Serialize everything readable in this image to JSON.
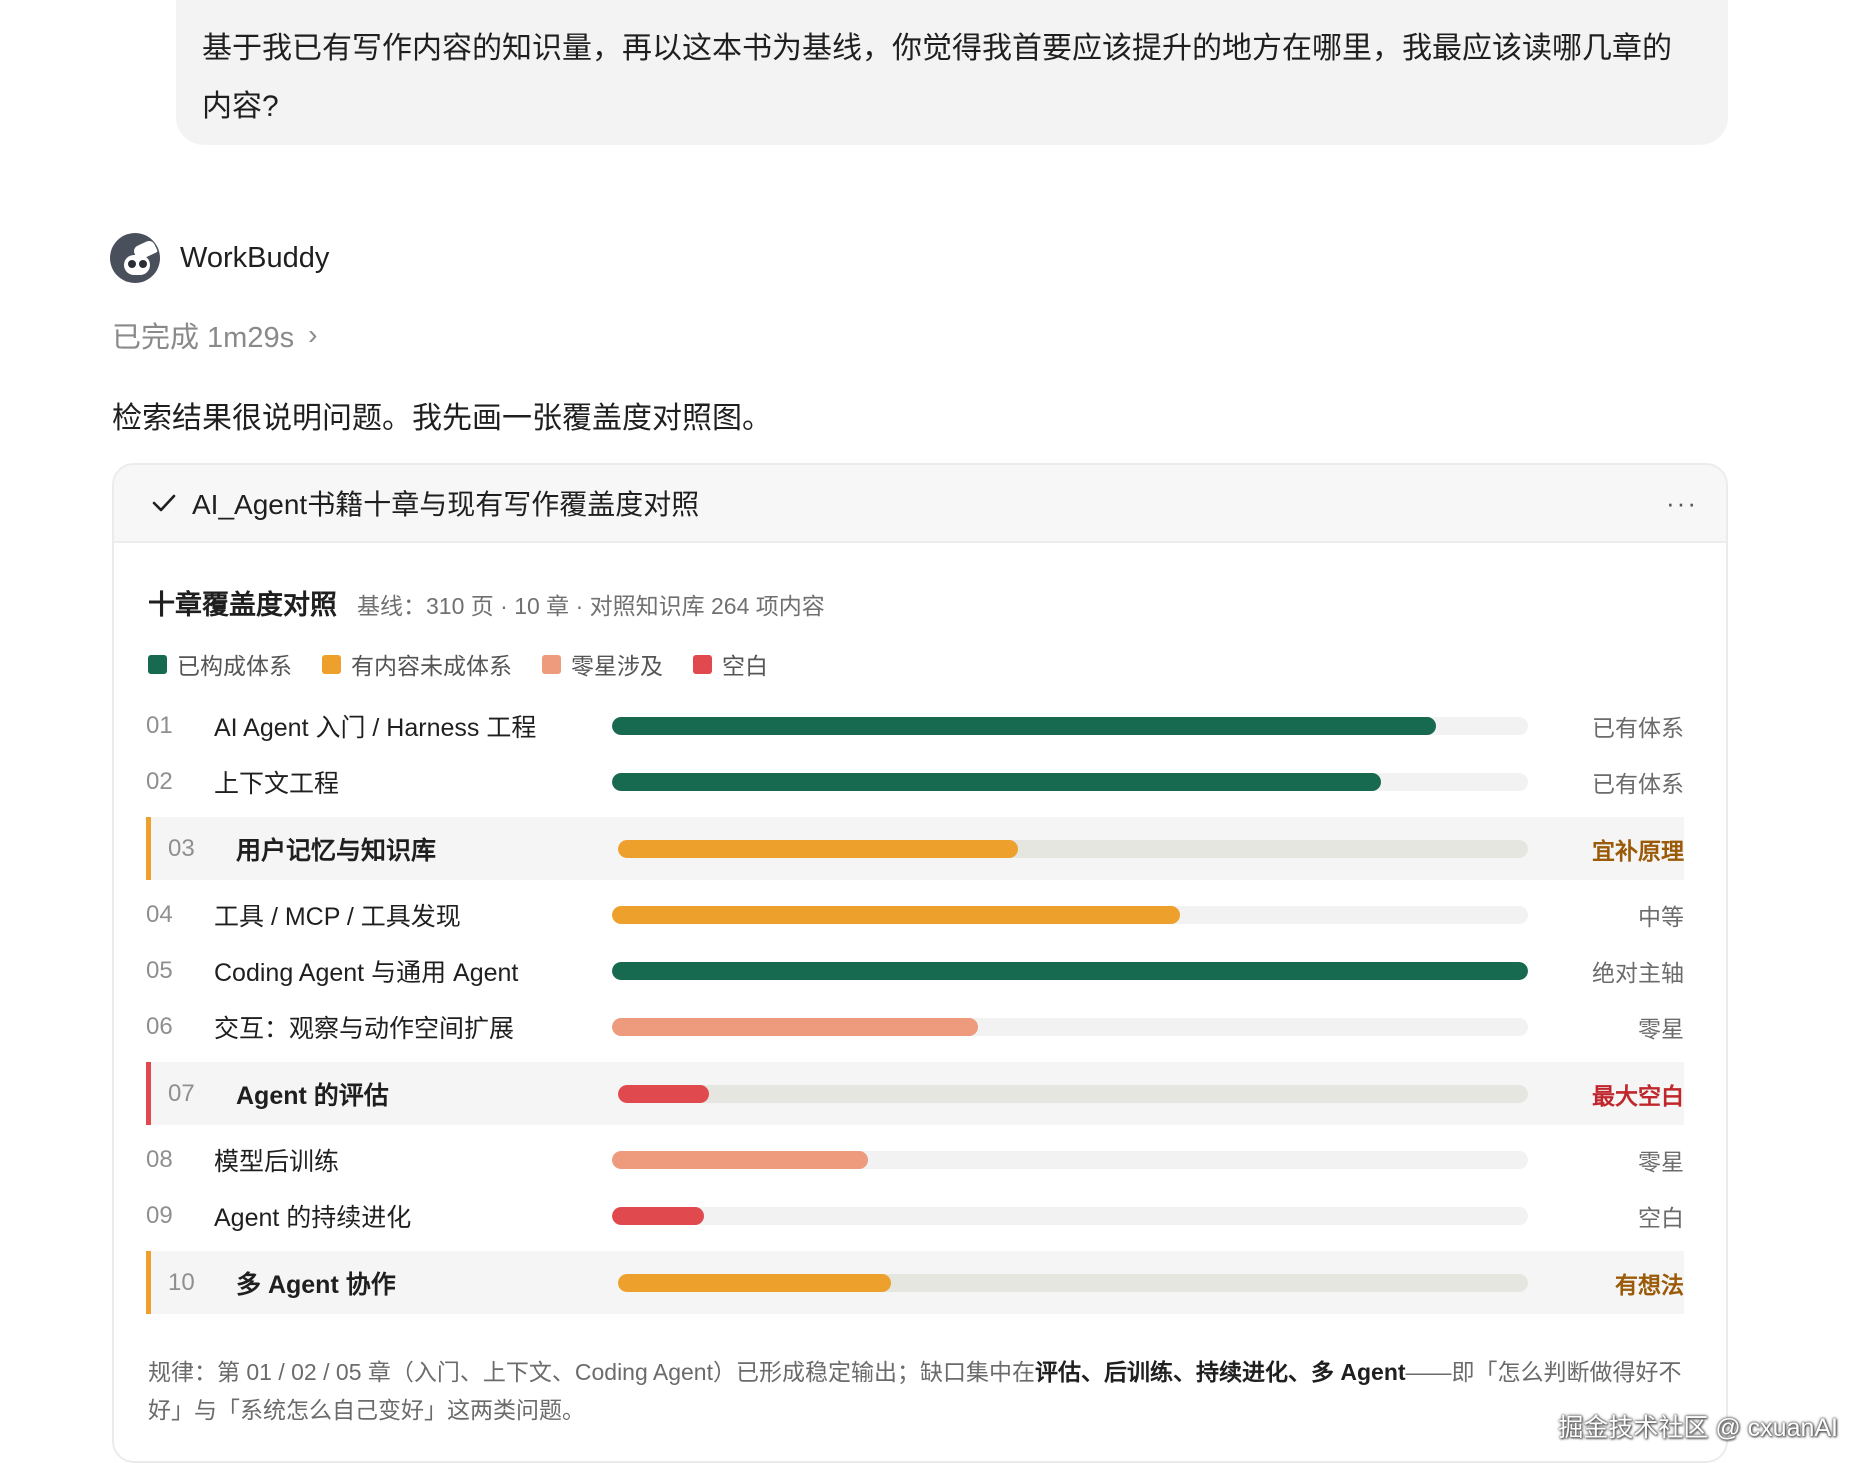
{
  "user_message": {
    "line1": "基于我已有写作内容的知识量，再以这本书为基线，你觉得我首要应该提升的地方在哪里，我最应该读哪几章的",
    "line2": "内容?"
  },
  "agent": {
    "name": "WorkBuddy",
    "status": "已完成 1m29s",
    "status_icon": "chevron-right-icon",
    "intro": "检索结果很说明问题。我先画一张覆盖度对照图。"
  },
  "card": {
    "title": "AI_Agent书籍十章与现有写作覆盖度对照",
    "more": "···"
  },
  "chart_data": {
    "type": "bar",
    "title": "十章覆盖度对照",
    "subtitle": "基线：310 页 · 10 章 · 对照知识库 264 项内容",
    "legend": [
      {
        "label": "已构成体系",
        "color": "#17694f"
      },
      {
        "label": "有内容未成体系",
        "color": "#eea02c"
      },
      {
        "label": "零星涉及",
        "color": "#ee9a7c"
      },
      {
        "label": "空白",
        "color": "#e04a4e"
      }
    ],
    "xlim": [
      0,
      1
    ],
    "rows": [
      {
        "num": "01",
        "label": "AI Agent 入门 / Harness 工程",
        "value": 0.9,
        "color": "#17694f",
        "tag": "已有体系",
        "highlight": false
      },
      {
        "num": "02",
        "label": "上下文工程",
        "value": 0.84,
        "color": "#17694f",
        "tag": "已有体系",
        "highlight": false
      },
      {
        "num": "03",
        "label": "用户记忆与知识库",
        "value": 0.44,
        "color": "#eea02c",
        "tag": "宜补原理",
        "tag_color": "#9a5a08",
        "accent": "#eea02c",
        "highlight": true
      },
      {
        "num": "04",
        "label": "工具 / MCP / 工具发现",
        "value": 0.62,
        "color": "#eea02c",
        "tag": "中等",
        "highlight": false
      },
      {
        "num": "05",
        "label": "Coding Agent 与通用 Agent",
        "value": 1.0,
        "color": "#17694f",
        "tag": "绝对主轴",
        "highlight": false
      },
      {
        "num": "06",
        "label": "交互：观察与动作空间扩展",
        "value": 0.4,
        "color": "#ee9a7c",
        "tag": "零星",
        "highlight": false
      },
      {
        "num": "07",
        "label": "Agent 的评估",
        "value": 0.1,
        "color": "#e04a4e",
        "tag": "最大空白",
        "tag_color": "#c0272d",
        "accent": "#e04a4e",
        "highlight": true
      },
      {
        "num": "08",
        "label": "模型后训练",
        "value": 0.28,
        "color": "#ee9a7c",
        "tag": "零星",
        "highlight": false
      },
      {
        "num": "09",
        "label": "Agent 的持续进化",
        "value": 0.1,
        "color": "#e04a4e",
        "tag": "空白",
        "highlight": false
      },
      {
        "num": "10",
        "label": "多 Agent 协作",
        "value": 0.3,
        "color": "#eea02c",
        "tag": "有想法",
        "tag_color": "#9a5a08",
        "accent": "#eea02c",
        "highlight": true
      }
    ]
  },
  "footnote": {
    "prefix": "规律：第 01 / 02 / 05 章（入门、上下文、Coding Agent）已形成稳定输出；缺口集中在",
    "bold": "评估、后训练、持续进化、多 Agent",
    "suffix": "——即「怎么判断做得好不好」与「系统怎么自己变好」这两类问题。"
  },
  "watermark": "掘金技术社区 @ cxuanAI"
}
